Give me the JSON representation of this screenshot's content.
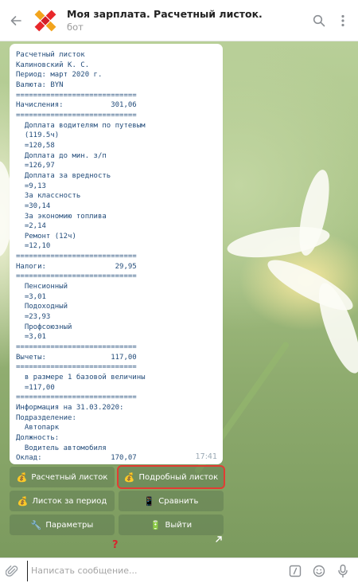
{
  "header": {
    "title": "Моя зарплата. Расчетный листок.",
    "subtitle": "бот",
    "back_icon": "back-arrow-icon",
    "search_icon": "search-icon",
    "menu_icon": "more-vert-icon"
  },
  "message": {
    "lines": [
      "Расчетный листок",
      "Калиновский К. С.",
      "Период: март 2020 г.",
      "Валюта: BYN",
      "============================",
      "Начисления:           301,06",
      "============================",
      "  Доплата водителям по путевым",
      "  (119.5ч)",
      "  =120,58",
      "  Доплата до мин. з/п",
      "  =126,97",
      "  Доплата за вредность",
      "  =9,13",
      "  За классность",
      "  =30,14",
      "  За экономию топлива",
      "  =2,14",
      "  Ремонт (12ч)",
      "  =12,10",
      "============================",
      "Налоги:                29,95",
      "============================",
      "  Пенсионный",
      "  =3,01",
      "  Подоходный",
      "  =23,93",
      "  Профсоюзный",
      "  =3,01",
      "============================",
      "Вычеты:               117,00",
      "============================",
      "  в размере 1 базовой величины",
      "  =117,00",
      "============================",
      "Информация на 31.03.2020:",
      "Подразделение:",
      "  Автопарк",
      "Должность:",
      "  Водитель автомобиля",
      "Оклад:                170,07"
    ],
    "time": "17:41"
  },
  "keyboard": {
    "btn_payslip": "Расчетный листок",
    "btn_detailed": "Подробный листок",
    "btn_period": "Листок за период",
    "btn_compare": "Сравнить",
    "btn_params": "Параметры",
    "btn_exit": "Выйти",
    "emoji_bag": "💰",
    "emoji_phone": "📱",
    "emoji_wrench": "🔧",
    "emoji_box": "🔋"
  },
  "annotation": {
    "mark": "?"
  },
  "input": {
    "placeholder": "Написать сообщение...",
    "attach_icon": "paperclip-icon",
    "commands_icon": "slash-commands-icon",
    "emoji_icon": "smile-icon",
    "voice_icon": "microphone-icon"
  },
  "colors": {
    "accent": "#234c7a",
    "highlight_box": "#e23c33",
    "kb_button": "#5a7650",
    "annotation": "#d9232e"
  }
}
